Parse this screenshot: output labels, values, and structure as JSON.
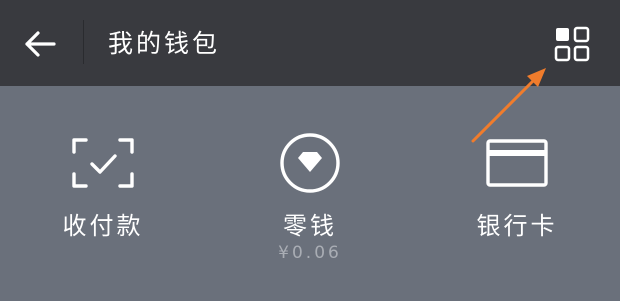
{
  "header": {
    "title": "我的钱包",
    "back_icon": "arrow-left-icon",
    "more_icon": "grid-icon"
  },
  "actions": [
    {
      "label": "收付款",
      "icon": "scan-check-icon"
    },
    {
      "label": "零钱",
      "icon": "diamond-circle-icon",
      "sub": "¥0.06"
    },
    {
      "label": "银行卡",
      "icon": "card-icon"
    }
  ],
  "colors": {
    "topbar": "#393a3f",
    "panel": "#6a707b",
    "annotation_arrow": "#f07c2c"
  }
}
